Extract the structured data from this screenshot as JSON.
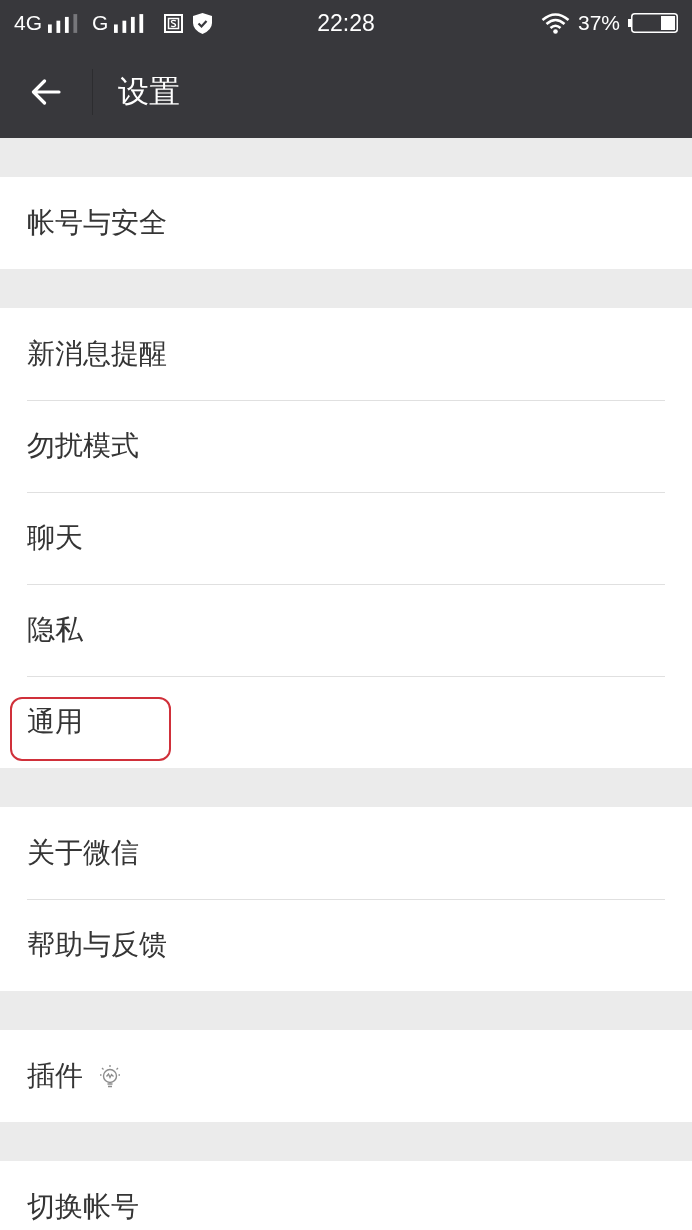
{
  "status_bar": {
    "networks": [
      {
        "label": "4G"
      },
      {
        "label": "G"
      }
    ],
    "time": "22:28",
    "battery": "37%"
  },
  "header": {
    "title": "设置"
  },
  "groups": [
    {
      "items": [
        {
          "label": "帐号与安全",
          "kind": "text",
          "highlighted": false
        }
      ]
    },
    {
      "items": [
        {
          "label": "新消息提醒",
          "kind": "text",
          "highlighted": false
        },
        {
          "label": "勿扰模式",
          "kind": "text",
          "highlighted": false
        },
        {
          "label": "聊天",
          "kind": "text",
          "highlighted": false
        },
        {
          "label": "隐私",
          "kind": "text",
          "highlighted": false
        },
        {
          "label": "通用",
          "kind": "text",
          "highlighted": true
        }
      ]
    },
    {
      "items": [
        {
          "label": "关于微信",
          "kind": "text",
          "highlighted": false
        },
        {
          "label": "帮助与反馈",
          "kind": "text",
          "highlighted": false
        }
      ]
    },
    {
      "items": [
        {
          "label": "插件",
          "kind": "text_icon",
          "highlighted": false
        }
      ]
    },
    {
      "items": [
        {
          "label": "切换帐号",
          "kind": "text",
          "highlighted": false
        }
      ]
    }
  ]
}
